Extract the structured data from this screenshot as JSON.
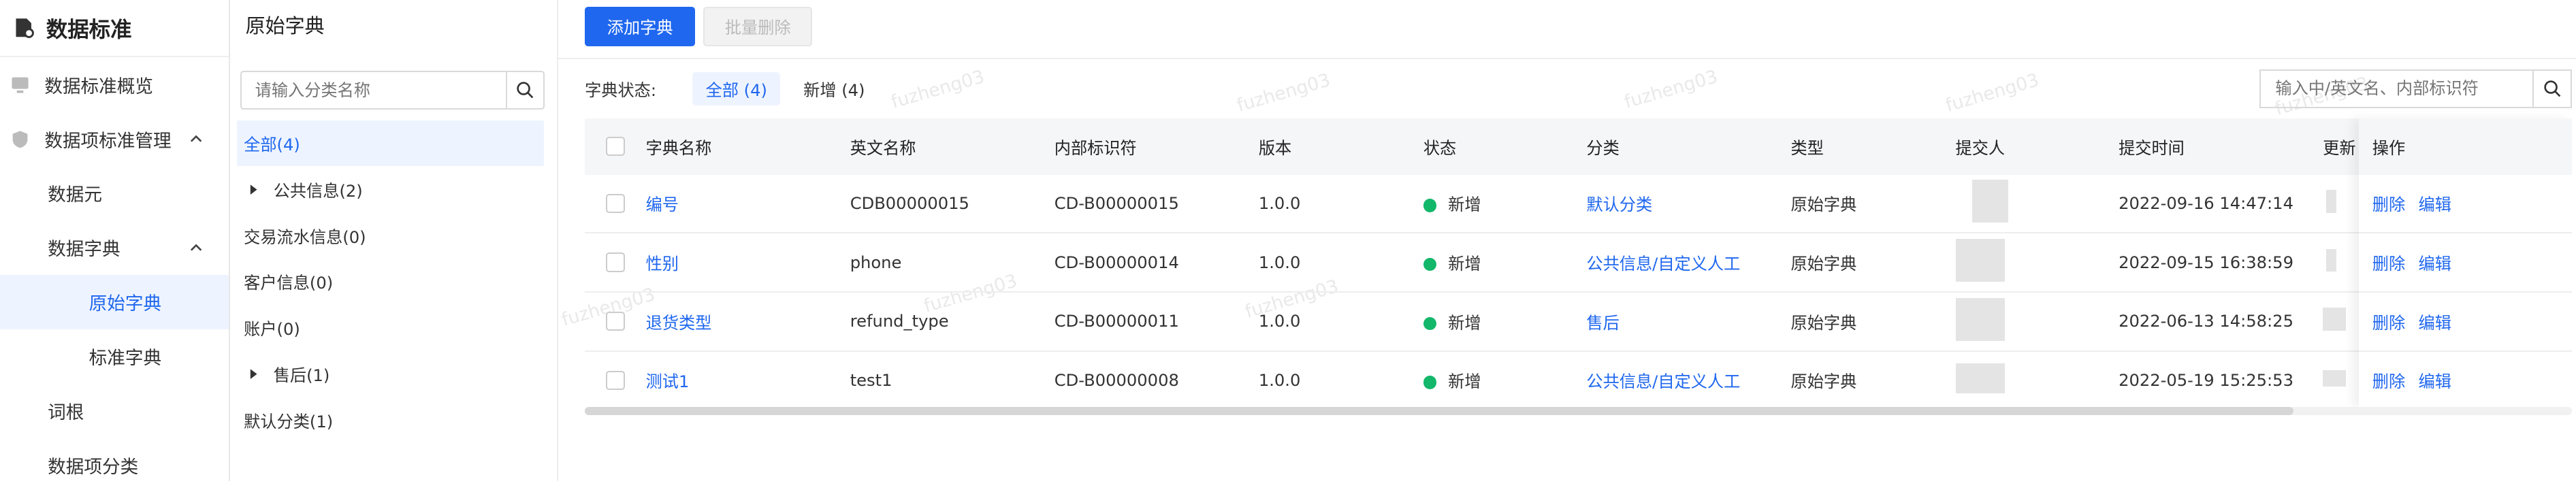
{
  "sidebar": {
    "title": "数据标准",
    "items": [
      {
        "label": "数据标准概览"
      },
      {
        "label": "数据项标准管理"
      },
      {
        "label": "数据元"
      },
      {
        "label": "数据字典"
      },
      {
        "label": "原始字典"
      },
      {
        "label": "标准字典"
      },
      {
        "label": "词根"
      },
      {
        "label": "数据项分类"
      }
    ]
  },
  "tree": {
    "title": "原始字典",
    "search_placeholder": "请输入分类名称",
    "nodes": [
      {
        "label": "全部(4)"
      },
      {
        "label": "公共信息(2)"
      },
      {
        "label": "交易流水信息(0)"
      },
      {
        "label": "客户信息(0)"
      },
      {
        "label": "账户(0)"
      },
      {
        "label": "售后(1)"
      },
      {
        "label": "默认分类(1)"
      }
    ]
  },
  "toolbar": {
    "add_label": "添加字典",
    "batch_delete_label": "批量删除"
  },
  "filter": {
    "label": "字典状态:",
    "tabs": [
      {
        "label": "全部 (4)"
      },
      {
        "label": "新增 (4)"
      }
    ]
  },
  "search": {
    "placeholder": "输入中/英文名、内部标识符"
  },
  "table": {
    "headers": {
      "name": "字典名称",
      "en": "英文名称",
      "id": "内部标识符",
      "version": "版本",
      "status": "状态",
      "category": "分类",
      "type": "类型",
      "submitter": "提交人",
      "submit_time": "提交时间",
      "update": "更新",
      "ops": "操作"
    },
    "rows": [
      {
        "name": "编号",
        "en": "CDB00000015",
        "id": "CD-B00000015",
        "version": "1.0.0",
        "status": "新增",
        "category": "默认分类",
        "type": "原始字典",
        "time": "2022-09-16 14:47:14",
        "del": "删除",
        "edit": "编辑"
      },
      {
        "name": "性别",
        "en": "phone",
        "id": "CD-B00000014",
        "version": "1.0.0",
        "status": "新增",
        "category": "公共信息/自定义人工",
        "type": "原始字典",
        "time": "2022-09-15 16:38:59",
        "del": "删除",
        "edit": "编辑"
      },
      {
        "name": "退货类型",
        "en": "refund_type",
        "id": "CD-B00000011",
        "version": "1.0.0",
        "status": "新增",
        "category": "售后",
        "type": "原始字典",
        "time": "2022-06-13 14:58:25",
        "del": "删除",
        "edit": "编辑"
      },
      {
        "name": "测试1",
        "en": "test1",
        "id": "CD-B00000008",
        "version": "1.0.0",
        "status": "新增",
        "category": "公共信息/自定义人工",
        "type": "原始字典",
        "time": "2022-05-19 15:25:53",
        "del": "删除",
        "edit": "编辑"
      }
    ]
  },
  "watermark": "fuzheng03",
  "colors": {
    "accent": "#1f67ee",
    "status_new": "#12b76a"
  }
}
